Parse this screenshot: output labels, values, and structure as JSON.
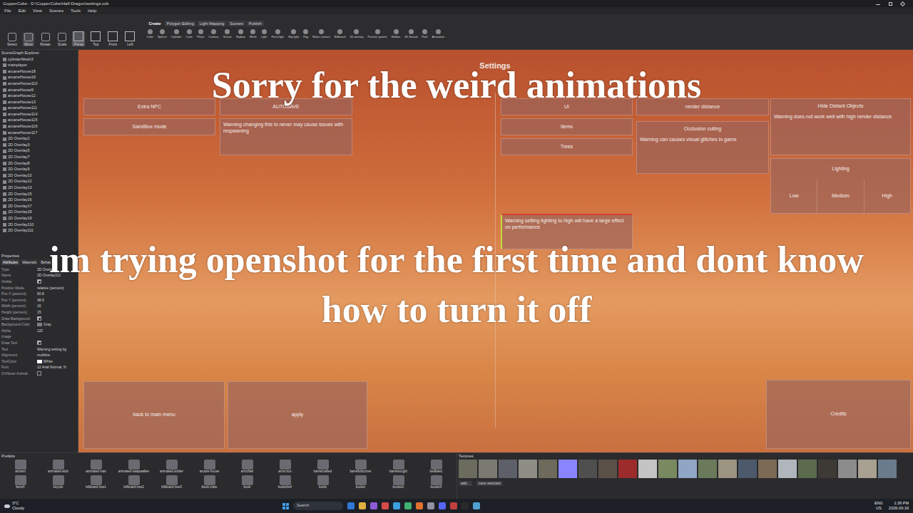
{
  "window": {
    "title": "CopperCube - D:\\CopperCube\\Half-Dragon\\settings.ccb"
  },
  "menu": [
    "File",
    "Edit",
    "View",
    "Scenes",
    "Tools",
    "Help"
  ],
  "toolbar": {
    "tools": [
      {
        "label": "Select",
        "selected": false
      },
      {
        "label": "Move",
        "selected": true
      },
      {
        "label": "Rotate",
        "selected": false
      },
      {
        "label": "Scale",
        "selected": false
      }
    ],
    "views": [
      {
        "label": "Persp",
        "selected": true
      },
      {
        "label": "Top",
        "selected": false
      },
      {
        "label": "Front",
        "selected": false
      },
      {
        "label": "Left",
        "selected": false
      }
    ]
  },
  "ribbon": {
    "tabs": [
      {
        "label": "Create",
        "selected": true
      },
      {
        "label": "Polygon Editing",
        "selected": false
      },
      {
        "label": "Light Mapping",
        "selected": false
      },
      {
        "label": "Scenes",
        "selected": false
      },
      {
        "label": "Publish",
        "selected": false
      }
    ],
    "items": [
      "Cube",
      "Sphere",
      "Cylinder",
      "Cone",
      "Plane",
      "Camera",
      "Terrain",
      "Skybox",
      "Mesh",
      "Light",
      "Point light",
      "Sky light",
      "Fog",
      "Water surface",
      "Billboard",
      "2D overlay",
      "Particle system",
      "Hotbox",
      "3D Sound",
      "Path",
      "Animation"
    ]
  },
  "scene_graph": {
    "title": "SceneGraph Explorer",
    "items": [
      "cylinderMesh3",
      "mainplayer",
      "arcaneHouse18",
      "arcaneHouse19",
      "arcaneHouse110",
      "arcaneHouse9",
      "arcaneHouse12",
      "arcaneHouse13",
      "arcaneHouse111",
      "arcaneHouse114",
      "arcaneHouse115",
      "arcaneHouse116",
      "arcaneHouse117",
      "2D Overlay2",
      "2D Overlay3",
      "2D Overlay5",
      "2D Overlay7",
      "2D Overlay8",
      "2D Overlay9",
      "2D Overlay10",
      "2D Overlay12",
      "2D Overlay13",
      "2D Overlay15",
      "2D Overlay16",
      "2D Overlay17",
      "2D Overlay18",
      "2D Overlay19",
      "2D Overlay110",
      "2D Overlay111"
    ]
  },
  "properties": {
    "title": "Properties",
    "tabs": [
      {
        "label": "Attributes",
        "selected": true
      },
      {
        "label": "Materials",
        "selected": false
      },
      {
        "label": "Behav",
        "selected": false
      }
    ],
    "rows": [
      {
        "label": "Type",
        "kind": "text",
        "value": "2D Overlay"
      },
      {
        "label": "Name",
        "kind": "text",
        "value": "2D Overlay112"
      },
      {
        "label": "Visible",
        "kind": "checkbox",
        "checked": true
      },
      {
        "label": "Position Mode",
        "kind": "text",
        "value": "relative (percent)"
      },
      {
        "label": "Pos X (percent)",
        "kind": "text",
        "value": "60.8"
      },
      {
        "label": "Pos Y (percent)",
        "kind": "text",
        "value": "48.6"
      },
      {
        "label": "Width (percent)",
        "kind": "text",
        "value": "16"
      },
      {
        "label": "Height (percent)",
        "kind": "text",
        "value": "15"
      },
      {
        "label": "Draw Background",
        "kind": "checkbox",
        "checked": true
      },
      {
        "label": "Background Color",
        "kind": "color",
        "value": "Gray"
      },
      {
        "label": "Alpha",
        "kind": "text",
        "value": "120"
      },
      {
        "label": "Image",
        "kind": "text",
        "value": ""
      },
      {
        "label": "Draw Text",
        "kind": "checkbox",
        "checked": true
      },
      {
        "label": "Text",
        "kind": "text",
        "value": "Warning setting lig"
      },
      {
        "label": "Alignment",
        "kind": "text",
        "value": "multiline"
      },
      {
        "label": "TextColor",
        "kind": "color",
        "value": "White"
      },
      {
        "label": "Font",
        "kind": "text",
        "value": "12 Arial Normal, N"
      },
      {
        "label": "OnHover Animat",
        "kind": "checkbox",
        "checked": false
      }
    ]
  },
  "viewport": {
    "title": "Settings",
    "widgets": [
      {
        "kind": "button",
        "label": "Extra NPC"
      },
      {
        "kind": "button",
        "label": "AUTOSAVE"
      },
      {
        "kind": "button",
        "label": "SandBox mode"
      },
      {
        "kind": "note",
        "text": "Warning changing this to never may cause issues with respawning"
      },
      {
        "kind": "button",
        "label": "UI"
      },
      {
        "kind": "button",
        "label": "render distance"
      },
      {
        "kind": "button",
        "label": "Items"
      },
      {
        "kind": "option",
        "label": "Occlusion culling",
        "note": "Warning can causes visual glitches in game"
      },
      {
        "kind": "button",
        "label": "Trees"
      },
      {
        "kind": "option",
        "label": "Hide Distant Objects",
        "note": "Warning does not work well with high render distance"
      },
      {
        "kind": "choice",
        "label": "Lighting",
        "options": [
          "Low",
          "Medium",
          "High"
        ]
      },
      {
        "kind": "note",
        "text": "Warning setting lighting to high will have a large effect on performance"
      },
      {
        "kind": "button",
        "label": "back to main menu"
      },
      {
        "kind": "button",
        "label": "apply"
      },
      {
        "kind": "button",
        "label": "Credits"
      }
    ]
  },
  "prefabs": {
    "title": "Prefabs",
    "items": [
      "ancient",
      "animated stick",
      "animated man",
      "animated swapwalker",
      "animated soldier",
      "arcane house",
      "armchair",
      "arms box",
      "barrelcrafted",
      "barrelfullcorner",
      "barrelsought",
      "bedbasic",
      "bench",
      "bicycle",
      "billboard tree1",
      "billboard tree2",
      "billboard tree3",
      "block crate",
      "book",
      "bookshelf",
      "bottle",
      "bucket",
      "bucket2",
      "bucket3"
    ]
  },
  "textures": {
    "title": "Textures",
    "add": "add...",
    "selection": "none selected"
  },
  "taskbar": {
    "temperature": "3°C",
    "weather": "Cloudy",
    "search": "Search",
    "language": "ENG",
    "region": "US",
    "time": "1:36 PM",
    "date": "2026-03-16"
  },
  "captions": [
    "Sorry for the weird animations",
    "im trying openshot for the first time and dont know how to turn it off"
  ]
}
